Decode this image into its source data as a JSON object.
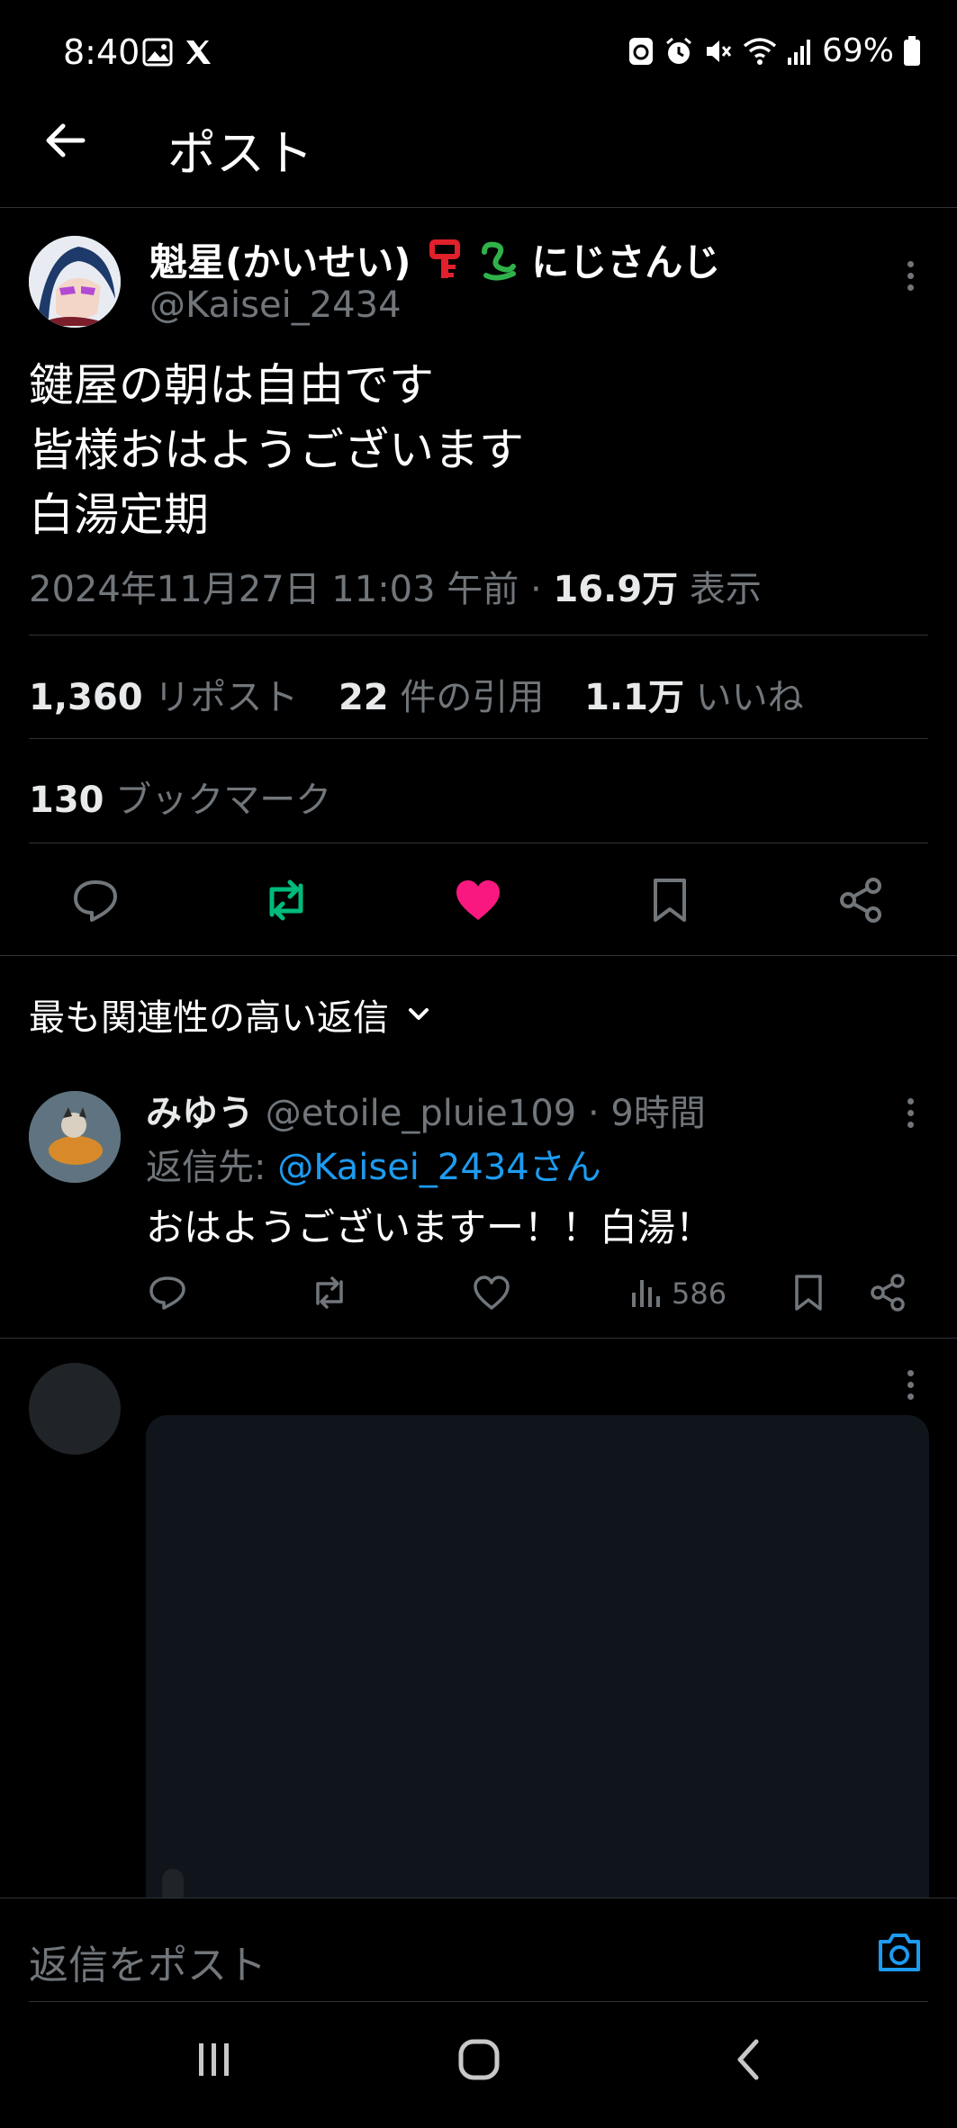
{
  "status_bar": {
    "time": "8:40",
    "battery": "69%"
  },
  "header": {
    "title": "ポスト"
  },
  "post": {
    "author_name": "魁星(かいせい)",
    "author_suffix": "にじさんじ",
    "author_handle": "@Kaisei_2434",
    "text": "鍵屋の朝は自由です\n皆様おはようございます\n白湯定期",
    "date": "2024年11月27日 11:03 午前",
    "views_count": "16.9万",
    "views_label": "表示",
    "reposts_count": "1,360",
    "reposts_label": "リポスト",
    "quotes_count": "22",
    "quotes_label": "件の引用",
    "likes_count": "1.1万",
    "likes_label": "いいね",
    "bookmarks_count": "130",
    "bookmarks_label": "ブックマーク"
  },
  "replies": {
    "sort_label": "最も関連性の高い返信",
    "items": [
      {
        "name": "みゆう",
        "handle": "@etoile_pluie109",
        "time": "9時間",
        "reply_to_label": "返信先:",
        "reply_to_handle": "@Kaisei_2434さん",
        "text": "おはようございますー！！白湯！",
        "views": "586"
      }
    ]
  },
  "composer": {
    "placeholder": "返信をポスト"
  },
  "colors": {
    "like": "#f91880",
    "repost": "#00ba7c",
    "link": "#1d9bf0"
  }
}
